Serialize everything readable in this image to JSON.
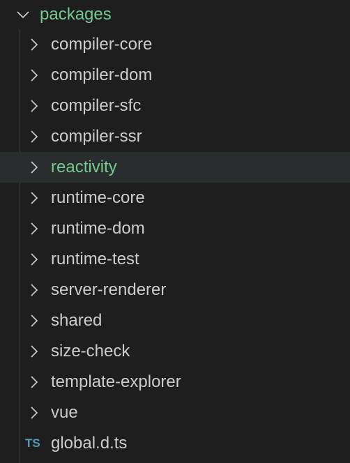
{
  "explorer": {
    "root_folder": {
      "label": "packages",
      "expanded": true,
      "icon": "chevron-down-icon"
    },
    "items": [
      {
        "label": "compiler-core",
        "type": "folder",
        "icon": "chevron-right-icon"
      },
      {
        "label": "compiler-dom",
        "type": "folder",
        "icon": "chevron-right-icon"
      },
      {
        "label": "compiler-sfc",
        "type": "folder",
        "icon": "chevron-right-icon"
      },
      {
        "label": "compiler-ssr",
        "type": "folder",
        "icon": "chevron-right-icon"
      },
      {
        "label": "reactivity",
        "type": "folder",
        "icon": "chevron-right-icon",
        "selected": true
      },
      {
        "label": "runtime-core",
        "type": "folder",
        "icon": "chevron-right-icon"
      },
      {
        "label": "runtime-dom",
        "type": "folder",
        "icon": "chevron-right-icon"
      },
      {
        "label": "runtime-test",
        "type": "folder",
        "icon": "chevron-right-icon"
      },
      {
        "label": "server-renderer",
        "type": "folder",
        "icon": "chevron-right-icon"
      },
      {
        "label": "shared",
        "type": "folder",
        "icon": "chevron-right-icon"
      },
      {
        "label": "size-check",
        "type": "folder",
        "icon": "chevron-right-icon"
      },
      {
        "label": "template-explorer",
        "type": "folder",
        "icon": "chevron-right-icon"
      },
      {
        "label": "vue",
        "type": "folder",
        "icon": "chevron-right-icon"
      },
      {
        "label": "global.d.ts",
        "type": "file",
        "icon": "typescript-file-icon",
        "badge": "TS"
      }
    ]
  },
  "colors": {
    "background": "#1e1e1e",
    "text": "#cccccc",
    "highlight_text": "#73c991",
    "selected_row": "#2a2d2e",
    "ts_badge": "#519aba"
  }
}
